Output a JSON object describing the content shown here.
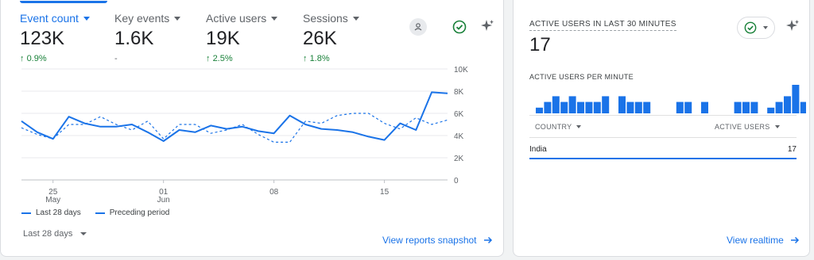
{
  "colors": {
    "accent": "#1a73e8",
    "positive": "#188038",
    "muted": "#5f6368"
  },
  "metrics": [
    {
      "label": "Event count",
      "value": "123K",
      "change": "0.9%",
      "trend": "up",
      "active": true
    },
    {
      "label": "Key events",
      "value": "1.6K",
      "change": "-",
      "trend": "none",
      "active": false
    },
    {
      "label": "Active users",
      "value": "19K",
      "change": "2.5%",
      "trend": "up",
      "active": false
    },
    {
      "label": "Sessions",
      "value": "26K",
      "change": "1.8%",
      "trend": "up",
      "active": false
    }
  ],
  "header_icons": [
    "insights-badge-icon",
    "check-circle-icon",
    "sparkle-icon"
  ],
  "chart_data": {
    "type": "line",
    "y_ticks": [
      "10K",
      "8K",
      "6K",
      "4K",
      "2K",
      "0"
    ],
    "x_ticks": [
      {
        "day": "25",
        "month": "May"
      },
      {
        "day": "01",
        "month": "Jun"
      },
      {
        "day": "08",
        "month": ""
      },
      {
        "day": "15",
        "month": ""
      }
    ],
    "ylim": [
      0,
      10000
    ],
    "x_start_date": "2024-05-23",
    "series": [
      {
        "name": "Last 28 days",
        "style": "solid",
        "values": [
          5300,
          4300,
          3700,
          5700,
          5100,
          4800,
          4800,
          5000,
          4300,
          3500,
          4500,
          4300,
          4900,
          4600,
          4800,
          4400,
          4200,
          5800,
          5000,
          4600,
          4500,
          4300,
          3900,
          3600,
          5100,
          4500,
          7900,
          7800
        ]
      },
      {
        "name": "Preceding period",
        "style": "dashed",
        "values": [
          4700,
          4100,
          3700,
          5000,
          5000,
          5700,
          5000,
          4500,
          5300,
          3700,
          5000,
          5000,
          4200,
          4500,
          5000,
          4100,
          3400,
          3400,
          5300,
          5100,
          5800,
          6000,
          6000,
          5100,
          4600,
          5600,
          5000,
          5400
        ]
      }
    ],
    "legend_position": "bottom-left"
  },
  "footer": {
    "date_range": "Last 28 days",
    "snapshot_link": "View reports snapshot"
  },
  "realtime": {
    "title": "ACTIVE USERS IN LAST 30 MINUTES",
    "value": "17",
    "per_minute_label": "ACTIVE USERS PER MINUTE",
    "per_minute_values": [
      1,
      2,
      3,
      2,
      3,
      2,
      2,
      2,
      3,
      0,
      3,
      2,
      2,
      2,
      0,
      0,
      0,
      2,
      2,
      0,
      2,
      0,
      0,
      0,
      2,
      2,
      2,
      0,
      1,
      2,
      3,
      5,
      2
    ],
    "table": {
      "headers": [
        "COUNTRY",
        "ACTIVE USERS"
      ],
      "rows": [
        {
          "country": "India",
          "users": "17",
          "share": 1.0
        }
      ]
    },
    "link": "View realtime"
  }
}
